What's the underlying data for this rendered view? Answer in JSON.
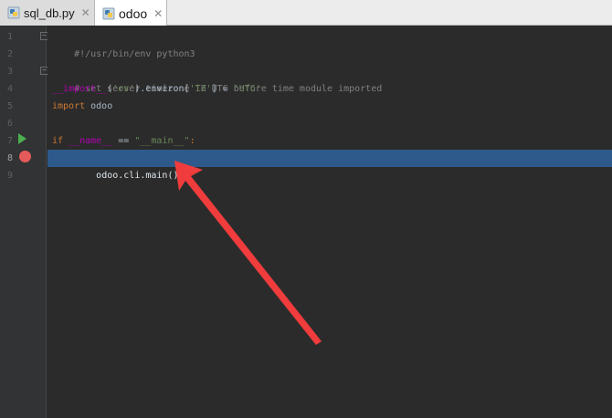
{
  "tabs": [
    {
      "label": "sql_db.py",
      "icon": "python-file-icon",
      "close": "✕",
      "active": false
    },
    {
      "label": "odoo",
      "icon": "python-file-icon",
      "close": "✕",
      "active": true
    }
  ],
  "gutter": {
    "line_numbers": [
      "1",
      "2",
      "3",
      "4",
      "5",
      "6",
      "7",
      "8",
      "9"
    ],
    "fold_open": "−",
    "run_marker_line": 7,
    "breakpoint_line": 8
  },
  "code": {
    "line1": "#!/usr/bin/env python3",
    "line2": "",
    "line3": "# set server timezone in UTC before time module imported",
    "line4": {
      "dunder": "__import__",
      "p1": "(",
      "s1": "'os'",
      "p2": ").environ[",
      "s2": "'TZ'",
      "p3": "] = ",
      "s3": "'UTC'"
    },
    "line5": {
      "kw": "import",
      "rest": " odoo"
    },
    "line6": "",
    "line7": {
      "kw": "if",
      "sp": " ",
      "dunder": "__name__",
      "op": " == ",
      "s": "\"__main__\"",
      "colon": ":"
    },
    "line8": "    odoo.cli.main()",
    "line9": ""
  },
  "colors": {
    "editor_bg": "#2b2b2b",
    "selection": "#2d5a8a",
    "comment": "#808080",
    "keyword": "#cc7832",
    "dunder": "#b200b2",
    "string": "#6a8759",
    "arrow": "#f03c3c",
    "breakpoint": "#e55a5a",
    "run": "#4caf50"
  }
}
